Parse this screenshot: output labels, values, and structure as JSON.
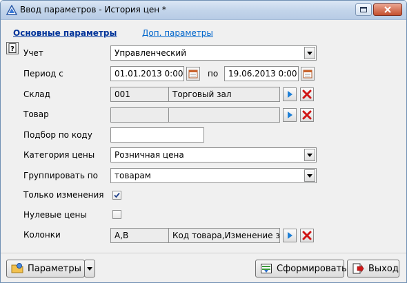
{
  "window": {
    "title": "Ввод параметров - История цен *"
  },
  "tabs": [
    {
      "label": "Основные параметры",
      "active": true
    },
    {
      "label": "Доп. параметры",
      "active": false
    }
  ],
  "form": {
    "uchet_label": "Учет",
    "uchet_value": "Управленческий",
    "period_label": "Период с",
    "period_from": "01.01.2013 0:00",
    "period_to_label": "по",
    "period_to": "19.06.2013 0:00",
    "sklad_label": "Склад",
    "sklad_code": "001",
    "sklad_name": "Торговый зал",
    "tovar_label": "Товар",
    "tovar_code": "",
    "tovar_name": "",
    "podbor_label": "Подбор по коду",
    "podbor_value": "",
    "category_label": "Категория цены",
    "category_value": "Розничная цена",
    "group_label": "Группировать по",
    "group_value": "товарам",
    "only_changes_label": "Только изменения",
    "only_changes_checked": true,
    "zero_prices_label": "Нулевые цены",
    "zero_prices_checked": false,
    "columns_label": "Колонки",
    "columns_code": "А,В",
    "columns_value": "Код товара,Изменение за"
  },
  "buttons": {
    "params": "Параметры",
    "generate": "Сформировать",
    "exit": "Выход"
  },
  "colors": {
    "accent_blue": "#1e7fd6",
    "delete_red": "#d01616",
    "link_blue": "#0066cc"
  }
}
